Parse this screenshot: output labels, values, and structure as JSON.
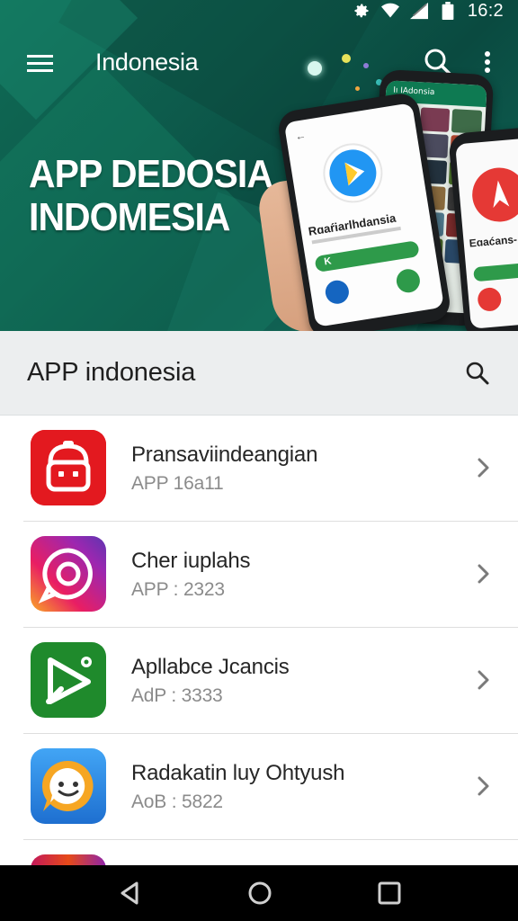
{
  "status_bar": {
    "time": "16:2",
    "icons": [
      "settings-icon",
      "wifi-icon",
      "signal-icon",
      "battery-icon"
    ]
  },
  "app_bar": {
    "title": "Indonesia",
    "icons": [
      "menu-icon",
      "search-icon",
      "more-vert-icon"
    ]
  },
  "hero": {
    "title_line1": "APP DEDOSIA",
    "title_line2": "INDOMESIA",
    "phone_back_header": "Iı IAdonsia",
    "phone_front_caption": "Rɑaŕiarlhdansia",
    "phone_front_button": "K",
    "phone_right_caption": "Eɑaćans-"
  },
  "section": {
    "label": "APP indonesia",
    "search_icon": "search-icon"
  },
  "apps": [
    {
      "name": "Pransaviindeangian",
      "sub": "APP 16a11",
      "icon": "red-cooker-icon",
      "color": "#e3191f"
    },
    {
      "name": "Cher iuplahs",
      "sub": "APP : 2323",
      "icon": "camera-chat-icon",
      "color": "#d8307c"
    },
    {
      "name": "Apllabce Jcancis",
      "sub": "AdP : 3333",
      "icon": "play-gear-icon",
      "color": "#1f8a2c"
    },
    {
      "name": "Radakatin luy Ohtyush",
      "sub": "AoB : 5822",
      "icon": "chat-bubble-icon",
      "color": "#3787e0"
    }
  ],
  "colors": {
    "hero_bg": "#0d5a4b",
    "section_bg": "#eceeef",
    "accent_green": "#1f8a2c"
  },
  "nav_bar": {
    "icons": [
      "back-icon",
      "home-icon",
      "recents-icon"
    ]
  }
}
